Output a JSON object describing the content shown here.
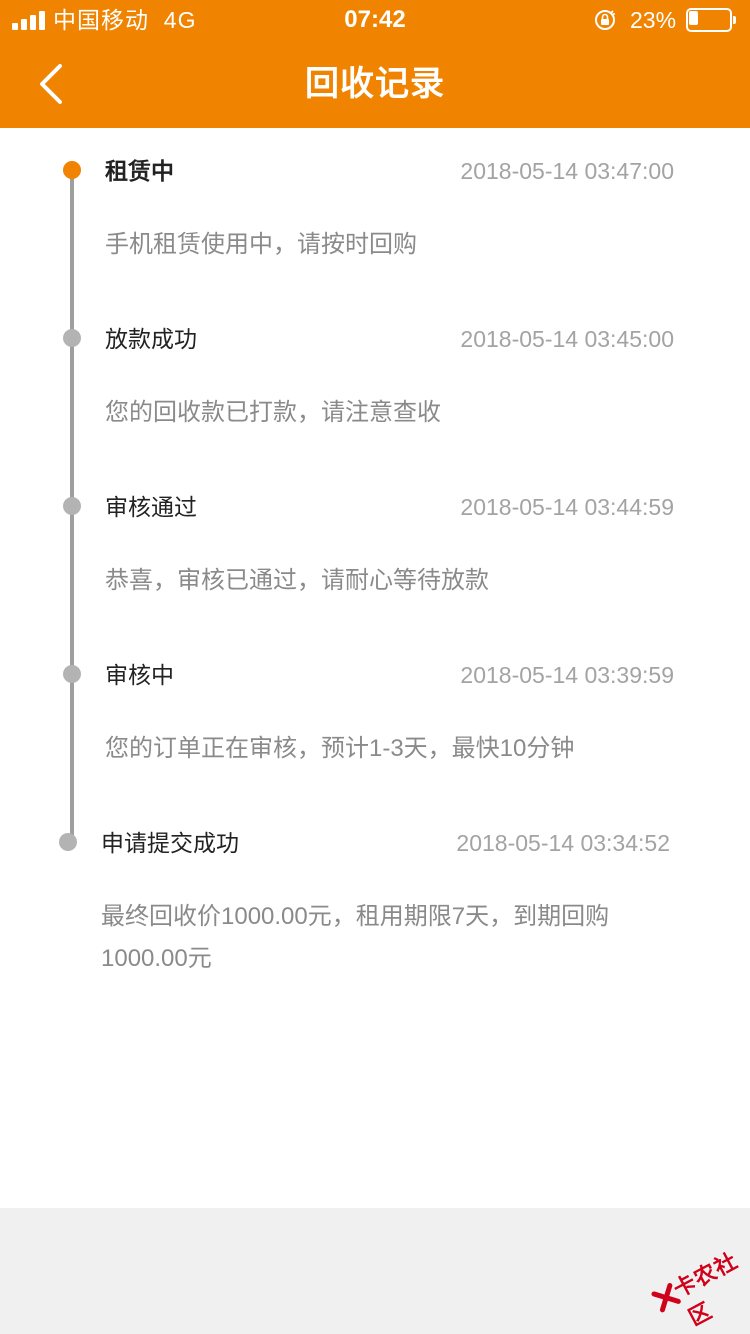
{
  "status_bar": {
    "carrier": "中国移动",
    "network": "4G",
    "time": "07:42",
    "battery_percent": "23%",
    "battery_level": 0.23,
    "signal_bars": 4
  },
  "nav": {
    "title": "回收记录",
    "back_icon": "chevron-left-icon"
  },
  "colors": {
    "accent": "#f08300",
    "timeline_line": "#9e9e9e",
    "dot_inactive": "#b3b3b3",
    "time_text": "#a3a3a3",
    "desc_text": "#8a8a8a",
    "watermark": "#d0021b"
  },
  "timeline": {
    "items": [
      {
        "title": "租赁中",
        "time": "2018-05-14 03:47:00",
        "description": "手机租赁使用中，请按时回购",
        "active": true
      },
      {
        "title": "放款成功",
        "time": "2018-05-14 03:45:00",
        "description": "您的回收款已打款，请注意查收",
        "active": false
      },
      {
        "title": "审核通过",
        "time": "2018-05-14 03:44:59",
        "description": "恭喜，审核已通过，请耐心等待放款",
        "active": false
      },
      {
        "title": "审核中",
        "time": "2018-05-14 03:39:59",
        "description": "您的订单正在审核，预计1-3天，最快10分钟",
        "active": false
      },
      {
        "title": "申请提交成功",
        "time": "2018-05-14 03:34:52",
        "description": "最终回收价1000.00元，租用期限7天，到期回购1000.00元",
        "active": false
      }
    ]
  },
  "watermark": {
    "text": "卡农社区"
  }
}
